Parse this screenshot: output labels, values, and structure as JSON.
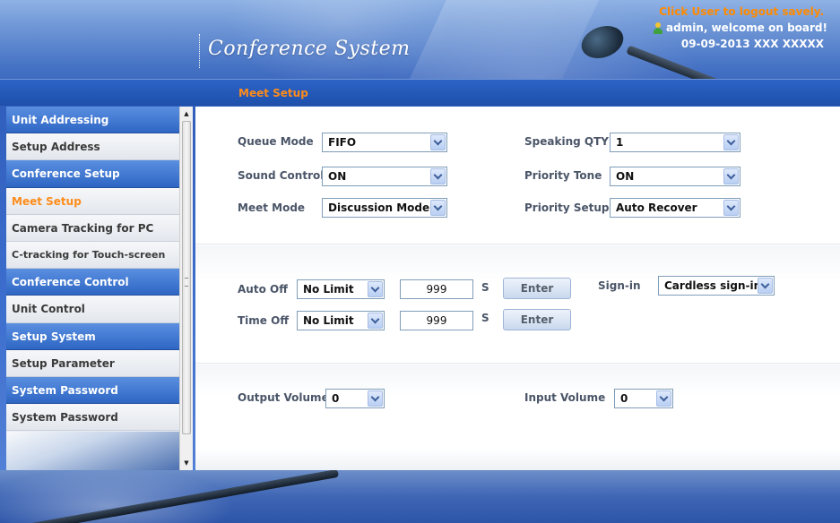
{
  "header": {
    "title": "Conference System",
    "logout_text": "Click User to logout savely.",
    "welcome_text": "admin, welcome on board!",
    "datetime_text": "09-09-2013  XXX  XXXXX"
  },
  "page_title": "Meet Setup",
  "sidebar": {
    "items": [
      {
        "label": "Unit Addressing",
        "kind": "group"
      },
      {
        "label": "Setup Address",
        "kind": "sub"
      },
      {
        "label": "Conference Setup",
        "kind": "group"
      },
      {
        "label": "Meet Setup",
        "kind": "sub",
        "active": true
      },
      {
        "label": "Camera Tracking for PC",
        "kind": "sub"
      },
      {
        "label": "C-tracking for Touch-screen",
        "kind": "sub"
      },
      {
        "label": "Conference Control",
        "kind": "group"
      },
      {
        "label": "Unit Control",
        "kind": "sub"
      },
      {
        "label": "Setup System",
        "kind": "group"
      },
      {
        "label": "Setup Parameter",
        "kind": "sub"
      },
      {
        "label": "System Password",
        "kind": "group"
      },
      {
        "label": "System Password",
        "kind": "sub"
      }
    ]
  },
  "form": {
    "queue_mode": {
      "label": "Queue Mode",
      "value": "FIFO"
    },
    "sound_control": {
      "label": "Sound Control",
      "value": "ON"
    },
    "meet_mode": {
      "label": "Meet Mode",
      "value": "Discussion Mode"
    },
    "speaking_qty": {
      "label": "Speaking QTY",
      "value": "1"
    },
    "priority_tone": {
      "label": "Priority Tone",
      "value": "ON"
    },
    "priority_setup": {
      "label": "Priority Setup",
      "value": "Auto Recover"
    },
    "auto_off": {
      "label": "Auto Off",
      "select_value": "No Limit",
      "input_value": "999",
      "unit": "S",
      "button": "Enter"
    },
    "time_off": {
      "label": "Time Off",
      "select_value": "No Limit",
      "input_value": "999",
      "unit": "S",
      "button": "Enter"
    },
    "sign_in": {
      "label": "Sign-in",
      "value": "Cardless sign-in"
    },
    "output_volume": {
      "label": "Output Volume",
      "value": "0"
    },
    "input_volume": {
      "label": "Input Volume",
      "value": "0"
    }
  },
  "colors": {
    "accent_orange": "#ff8c1a",
    "header_blue": "#2c64c6",
    "group_blue": "#2e66c4"
  }
}
